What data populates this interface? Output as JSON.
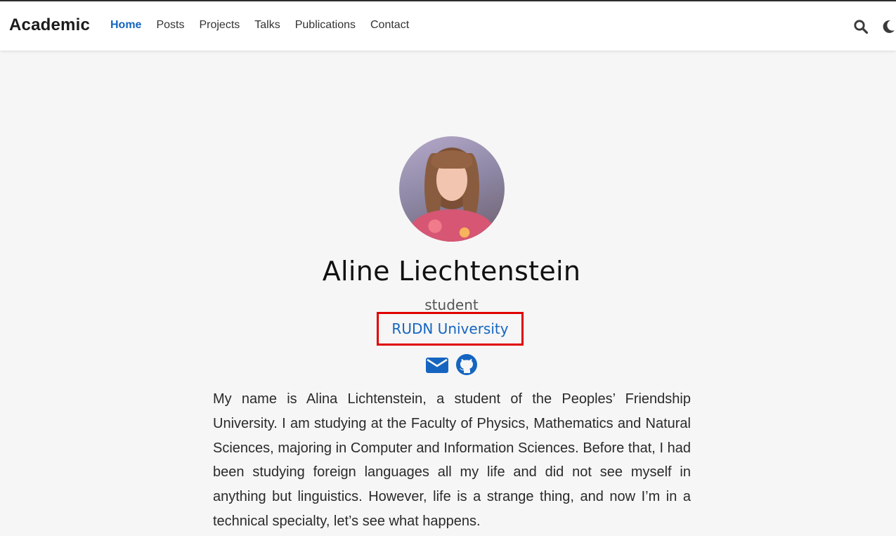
{
  "navbar": {
    "brand": "Academic",
    "links": [
      {
        "label": "Home",
        "active": true
      },
      {
        "label": "Posts",
        "active": false
      },
      {
        "label": "Projects",
        "active": false
      },
      {
        "label": "Talks",
        "active": false
      },
      {
        "label": "Publications",
        "active": false
      },
      {
        "label": "Contact",
        "active": false
      }
    ],
    "icons": [
      "search-icon",
      "moon-icon"
    ]
  },
  "profile": {
    "avatar": "profile-photo",
    "name": "Aline Liechtenstein",
    "role": "student",
    "organization": "RUDN University",
    "social_icons": [
      "envelope-icon",
      "github-icon"
    ],
    "bio": "My name is Alina Lichtenstein, a student of the Peoples’ Friendship University. I am studying at the Faculty of Physics, Mathematics and Natural Sciences, majoring in Computer and Information Sciences. Before that, I had been studying foreign languages all my life and did not see myself in anything but linguistics. However, life is a strange thing, and now I’m in a technical specialty, let’s see what happens."
  },
  "colors": {
    "accent": "#1565c0",
    "highlight_box": "#e00000",
    "background": "#f6f6f6"
  }
}
